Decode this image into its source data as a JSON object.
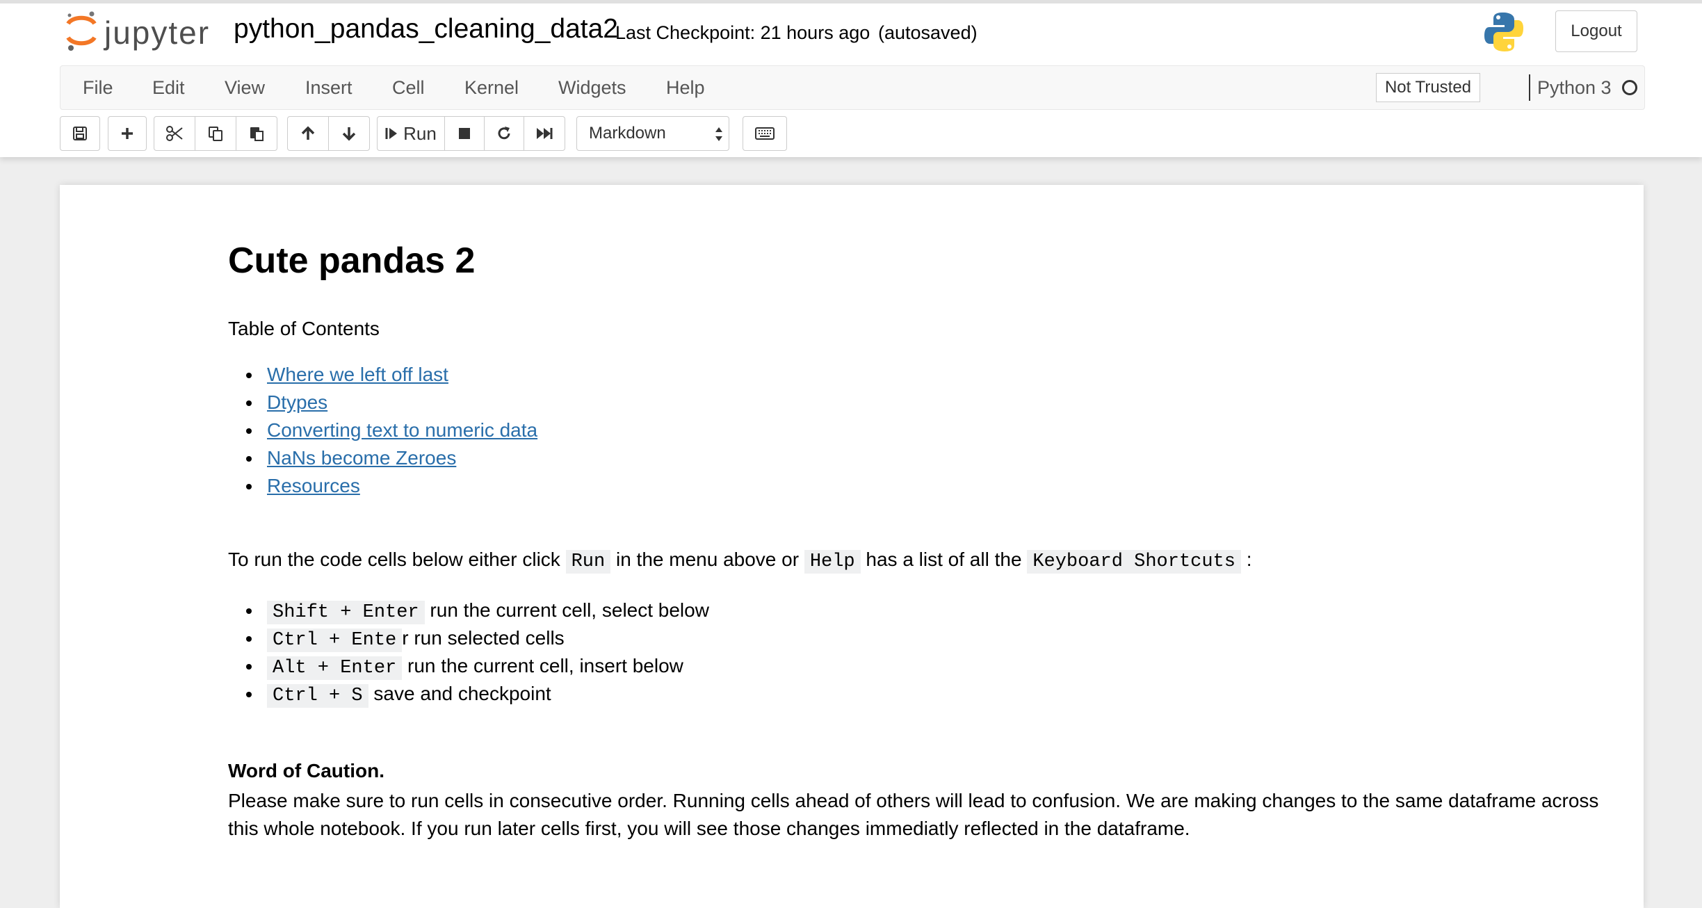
{
  "header": {
    "logo_text": "jupyter",
    "notebook_name": "python_pandas_cleaning_data2",
    "checkpoint": "Last Checkpoint: 21 hours ago",
    "autosave": "(autosaved)",
    "logout_label": "Logout"
  },
  "menu": {
    "items": [
      "File",
      "Edit",
      "View",
      "Insert",
      "Cell",
      "Kernel",
      "Widgets",
      "Help"
    ],
    "not_trusted": "Not Trusted",
    "kernel": "Python 3"
  },
  "toolbar": {
    "run_label": "Run",
    "cell_type": "Markdown"
  },
  "cell": {
    "title": "Cute pandas 2",
    "toc_label": "Table of Contents",
    "toc": [
      "Where we left off last",
      "Dtypes",
      "Converting text to numeric data",
      "NaNs become Zeroes",
      "Resources"
    ],
    "intro": {
      "p1": "To run the code cells below either click ",
      "c1": "Run",
      "p2": " in the menu above or ",
      "c2": "Help",
      "p3": " has a list of all the ",
      "c3": "Keyboard Shortcuts",
      "p4": " :"
    },
    "shortcuts": [
      {
        "code": "Shift + Enter",
        "text": " run the current cell, select below"
      },
      {
        "code": "Ctrl + Ente",
        "text": "r run selected cells"
      },
      {
        "code": "Alt + Enter",
        "text": " run the current cell, insert below"
      },
      {
        "code": "Ctrl + S",
        "text": " save and checkpoint"
      }
    ],
    "caution_title": "Word of Caution.",
    "caution_body": "Please make sure to run cells in consecutive order. Running cells ahead of others will lead to confusion. We are making changes to the same dataframe across this whole notebook. If you run later cells first, you will see those changes immediatly reflected in the dataframe."
  },
  "colors": {
    "link": "#296eaa",
    "jupyter_orange": "#f37726",
    "python_blue": "#3776ab",
    "python_yellow": "#ffd43b"
  }
}
